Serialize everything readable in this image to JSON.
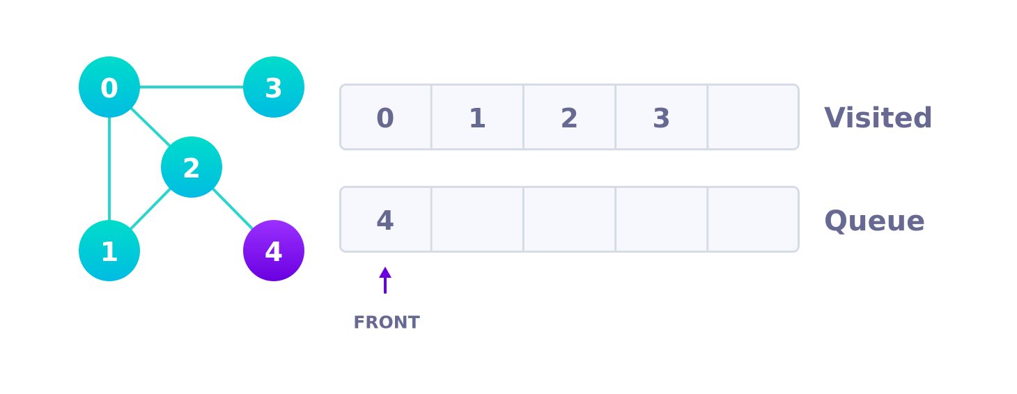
{
  "graph": {
    "nodes": [
      {
        "id": "0",
        "state": "default"
      },
      {
        "id": "3",
        "state": "default"
      },
      {
        "id": "2",
        "state": "default"
      },
      {
        "id": "1",
        "state": "default"
      },
      {
        "id": "4",
        "state": "current"
      }
    ],
    "edges": [
      [
        "0",
        "3"
      ],
      [
        "0",
        "2"
      ],
      [
        "0",
        "1"
      ],
      [
        "2",
        "1"
      ],
      [
        "2",
        "4"
      ]
    ]
  },
  "visited": {
    "label": "Visited",
    "cells": [
      "0",
      "1",
      "2",
      "3",
      ""
    ]
  },
  "queue": {
    "label": "Queue",
    "cells": [
      "4",
      "",
      "",
      "",
      ""
    ],
    "front_label": "FRONT"
  },
  "colors": {
    "node_gradient": [
      "#00DCCB",
      "#00BCE2"
    ],
    "current_gradient": [
      "#9B30FF",
      "#6A00E0"
    ],
    "edge": "#2AD6CB",
    "cell_fill": "#F7F8FE",
    "cell_border": "#D5DCE6",
    "text": "#676992",
    "arrow": "#6A00E0"
  }
}
